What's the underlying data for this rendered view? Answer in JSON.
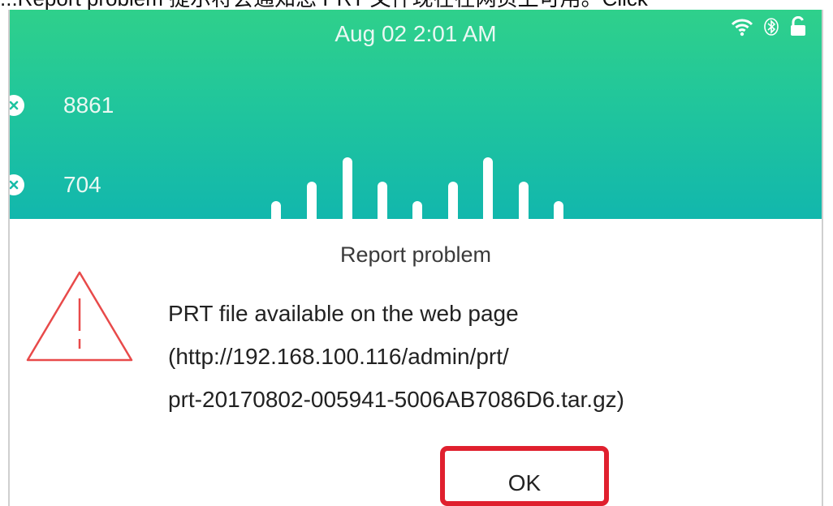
{
  "caption": "...Report problem 提示将会通知您 PRT 文件现在在网页上可用。Click",
  "status_bar": {
    "datetime": "Aug 02 2:01 AM",
    "icons": [
      "wifi-icon",
      "bluetooth-icon",
      "unlock-icon"
    ]
  },
  "lines": [
    {
      "number": "8861",
      "status_icon": "x-circle-icon"
    },
    {
      "number": "704",
      "status_icon": "x-circle-icon"
    }
  ],
  "dialog": {
    "title": "Report problem",
    "icon": "warning-triangle-icon",
    "message_lines": [
      "PRT file available on the web page",
      "(http://192.168.100.116/admin/prt/",
      "prt-20170802-005941-5006AB7086D6.tar.gz)"
    ],
    "ok_label": "OK"
  },
  "colors": {
    "header_top": "#2fd08b",
    "header_bottom": "#12b7ad",
    "warning_red": "#e84a4a",
    "highlight_red": "#e0202e"
  }
}
